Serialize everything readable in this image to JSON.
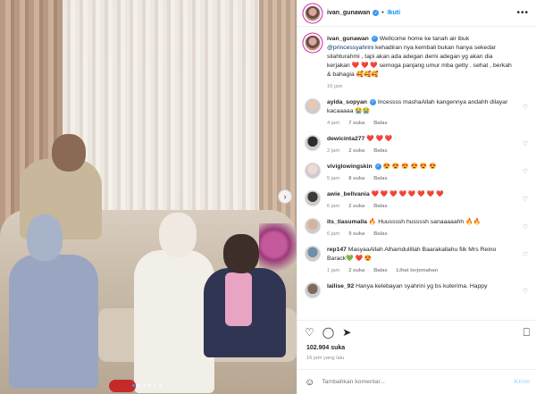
{
  "header": {
    "username": "ivan_gunawan",
    "separator": "•",
    "follow_label": "Ikuti",
    "more": "•••"
  },
  "caption": {
    "username": "ivan_gunawan",
    "text_before": " Wellcome home ke tanah air ibuk ",
    "mention": "@princessyahrini",
    "text_after": " kehadiran nya kembali bukan hanya sekedar silahturahmi , tapi akan ada adegan demi adegan yg akan dia kerjakan ",
    "hearts": "❤️ ❤️ ❤️",
    "text_end": " semoga panjang umur mba getty . sehat , berkah & bahagia 🥰🥰🥰",
    "time": "16 jam"
  },
  "comments": [
    {
      "username": "ayida_sopyan",
      "verified": true,
      "text": " Incessss mashaAllah kangennya andahh dilayar kacaaaaa 😭😭",
      "time": "4 jam",
      "likes": "7 suka",
      "reply": "Balas"
    },
    {
      "username": "dewicinta277",
      "verified": false,
      "text": " ❤️ ❤️ ❤️",
      "time": "2 jam",
      "likes": "2 suka",
      "reply": "Balas"
    },
    {
      "username": "viviglowingskin",
      "verified": true,
      "text": " 😍 😍 😍 😍 😍 😍",
      "time": "5 jam",
      "likes": "8 suka",
      "reply": "Balas"
    },
    {
      "username": "awie_bellvania",
      "verified": false,
      "text": " ❤️ ❤️ ❤️ ❤️ ❤️ ❤️ ❤️ ❤️",
      "time": "6 jam",
      "likes": "2 suka",
      "reply": "Balas"
    },
    {
      "username": "its_tiasumaila",
      "verified": false,
      "text": " 🔥 Huussssh hussssh sanaaaaahh 🔥🔥",
      "time": "6 jam",
      "likes": "9 suka",
      "reply": "Balas"
    },
    {
      "username": "rep147",
      "verified": false,
      "text": " MasyaaAllah Alhamdulillah Baarakallahu fiik Mrs Reino Barack💚 ❤️ 😍",
      "time": "1 jam",
      "likes": "2 suka",
      "reply": "Balas",
      "translate": "Lihat terjemahan"
    },
    {
      "username": "lailise_92",
      "verified": false,
      "text": " Hanya kelebayan syahrini yg bs kuterima. Happy",
      "time": "",
      "likes": "",
      "reply": ""
    }
  ],
  "footer": {
    "likes": "102.904 suka",
    "time_ago": "16 jam yang lalu",
    "comment_placeholder": "Tambahkan komentar...",
    "post_label": "Kirim"
  },
  "photo": {
    "dots_total": 6,
    "dots_active_index": 0
  }
}
